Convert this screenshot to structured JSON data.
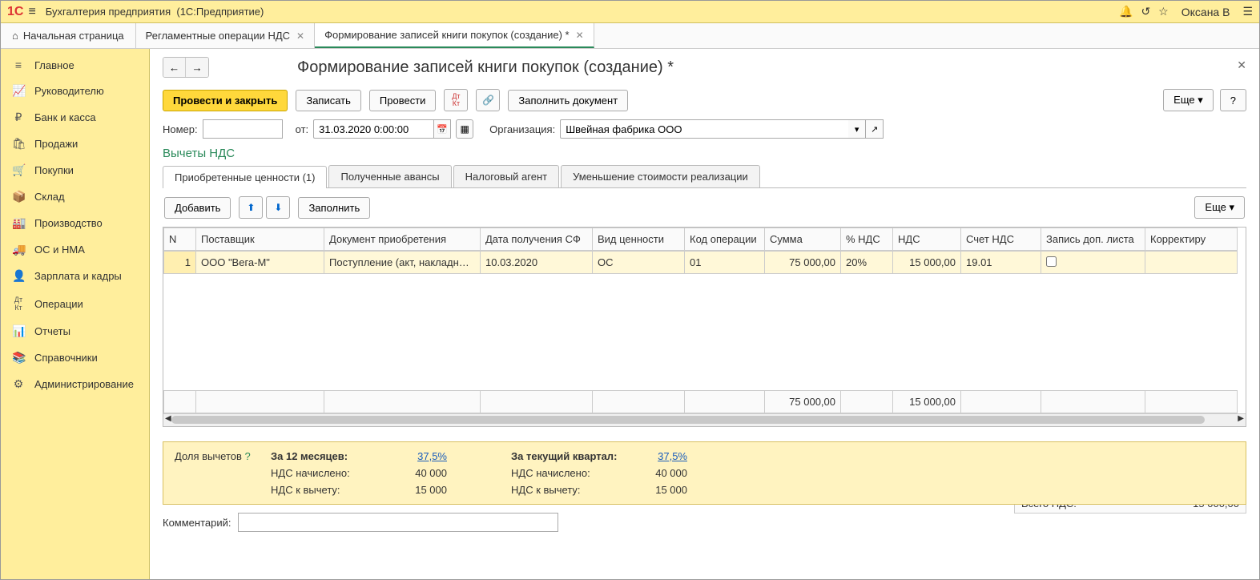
{
  "titlebar": {
    "app_name": "Бухгалтерия предприятия",
    "platform": "(1С:Предприятие)",
    "user": "Оксана В"
  },
  "tabs": {
    "home": "Начальная страница",
    "t1": "Регламентные операции НДС",
    "t2": "Формирование записей книги покупок (создание) *"
  },
  "sidebar": {
    "items": [
      {
        "label": "Главное",
        "icon": "≡"
      },
      {
        "label": "Руководителю",
        "icon": "📈"
      },
      {
        "label": "Банк и касса",
        "icon": "₽"
      },
      {
        "label": "Продажи",
        "icon": "🛍"
      },
      {
        "label": "Покупки",
        "icon": "🛒"
      },
      {
        "label": "Склад",
        "icon": "📦"
      },
      {
        "label": "Производство",
        "icon": "🏭"
      },
      {
        "label": "ОС и НМА",
        "icon": "🚚"
      },
      {
        "label": "Зарплата и кадры",
        "icon": "👤"
      },
      {
        "label": "Операции",
        "icon": "Дт/Кт"
      },
      {
        "label": "Отчеты",
        "icon": "📊"
      },
      {
        "label": "Справочники",
        "icon": "📚"
      },
      {
        "label": "Администрирование",
        "icon": "⚙"
      }
    ]
  },
  "page": {
    "title": "Формирование записей книги покупок (создание) *"
  },
  "toolbar": {
    "save_close": "Провести и закрыть",
    "write": "Записать",
    "post": "Провести",
    "fill_doc": "Заполнить документ",
    "more": "Еще",
    "help": "?"
  },
  "fields": {
    "number_label": "Номер:",
    "number_value": "",
    "from_label": "от:",
    "date_value": "31.03.2020 0:00:00",
    "org_label": "Организация:",
    "org_value": "Швейная фабрика ООО"
  },
  "section": "Вычеты НДС",
  "innertabs": {
    "t1": "Приобретенные ценности (1)",
    "t2": "Полученные авансы",
    "t3": "Налоговый агент",
    "t4": "Уменьшение стоимости реализации"
  },
  "subtoolbar": {
    "add": "Добавить",
    "fill": "Заполнить",
    "more": "Еще"
  },
  "table": {
    "headers": {
      "n": "N",
      "supplier": "Поставщик",
      "doc": "Документ приобретения",
      "date": "Дата получения СФ",
      "type": "Вид ценности",
      "opcode": "Код операции",
      "sum": "Сумма",
      "vat_pct": "% НДС",
      "vat": "НДС",
      "account": "Счет НДС",
      "extra": "Запись доп. листа",
      "corr": "Корректиру"
    },
    "rows": [
      {
        "n": "1",
        "supplier": "ООО \"Вега-М\"",
        "doc": "Поступление (акт, накладн…",
        "date": "10.03.2020",
        "type": "ОС",
        "opcode": "01",
        "sum": "75 000,00",
        "vat_pct": "20%",
        "vat": "15 000,00",
        "account": "19.01",
        "extra_checked": false
      }
    ],
    "totals": {
      "sum": "75 000,00",
      "vat": "15 000,00"
    }
  },
  "summary": {
    "label": "Доля вычетов",
    "q": "?",
    "period12_label": "За 12 месяцев:",
    "period12_pct": "37,5%",
    "periodq_label": "За текущий квартал:",
    "periodq_pct": "37,5%",
    "accrued_label": "НДС начислено:",
    "accrued12": "40 000",
    "accruedq": "40 000",
    "deduct_label": "НДС к вычету:",
    "deduct12": "15 000",
    "deductq": "15 000"
  },
  "total_vat": {
    "label": "Всего НДС:",
    "value": "15 000,00"
  },
  "comment": {
    "label": "Комментарий:",
    "value": ""
  }
}
